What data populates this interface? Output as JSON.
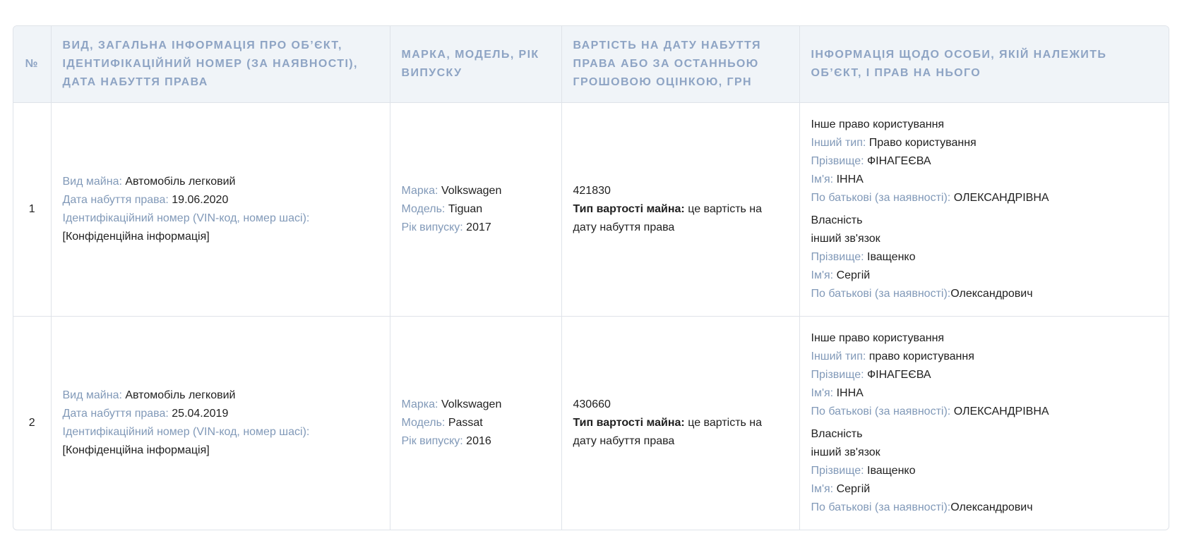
{
  "table": {
    "headers": {
      "num": "№",
      "general": "ВИД, ЗАГАЛЬНА ІНФОРМАЦІЯ ПРО ОБ’ЄКТ, ІДЕНТИФІКАЦІЙНИЙ НОМЕР (ЗА НАЯВНОСТІ), ДАТА НАБУТТЯ ПРАВА",
      "brand": "МАРКА, МОДЕЛЬ, РІК ВИПУСКУ",
      "value": "ВАРТІСТЬ НА ДАТУ НАБУТТЯ ПРАВА АБО ЗА ОСТАННЬОЮ ГРОШОВОЮ ОЦІНКОЮ, ГРН",
      "owner": "ІНФОРМАЦІЯ ЩОДО ОСОБИ, ЯКІЙ НАЛЕЖИТЬ ОБ’ЄКТ, І ПРАВ НА НЬОГО"
    },
    "rows": [
      {
        "num": "1",
        "general": {
          "type_label": "Вид майна:",
          "type_value": "Автомобіль легковий",
          "date_label": "Дата набуття права:",
          "date_value": "19.06.2020",
          "id_label": "Ідентифікаційний номер (VIN-код, номер шасі):",
          "id_value": "[Конфіденційна інформація]"
        },
        "brand": {
          "brand_label": "Марка:",
          "brand_value": "Volkswagen",
          "model_label": "Модель:",
          "model_value": "Tiguan",
          "year_label": "Рік випуску:",
          "year_value": "2017"
        },
        "value": {
          "amount": "421830",
          "cost_type_label": "Тип вартості майна:",
          "cost_type_value": "це вартість на дату набуття права"
        },
        "owner": {
          "right1": "Інше право користування",
          "other_type_label": "Інший тип:",
          "other_type_value": "Право користування",
          "surname_label": "Прізвище:",
          "surname_value": "ФІНАГЕЄВА",
          "name_label": "Ім'я:",
          "name_value": "ІННА",
          "patronymic_label": "По батькові (за наявності):",
          "patronymic_value": "ОЛЕКСАНДРІВНА",
          "right2": "Власність",
          "relation": "інший зв'язок",
          "surname2_label": "Прізвище:",
          "surname2_value": "Іващенко",
          "name2_label": "Ім'я:",
          "name2_value": "Сергій",
          "patronymic2_label": "По батькові (за наявності):",
          "patronymic2_value": "Олександрович"
        }
      },
      {
        "num": "2",
        "general": {
          "type_label": "Вид майна:",
          "type_value": "Автомобіль легковий",
          "date_label": "Дата набуття права:",
          "date_value": "25.04.2019",
          "id_label": "Ідентифікаційний номер (VIN-код, номер шасі):",
          "id_value": "[Конфіденційна інформація]"
        },
        "brand": {
          "brand_label": "Марка:",
          "brand_value": "Volkswagen",
          "model_label": "Модель:",
          "model_value": "Passat",
          "year_label": "Рік випуску:",
          "year_value": "2016"
        },
        "value": {
          "amount": "430660",
          "cost_type_label": "Тип вартості майна:",
          "cost_type_value": "це вартість на дату набуття права"
        },
        "owner": {
          "right1": "Інше право користування",
          "other_type_label": "Інший тип:",
          "other_type_value": "право користування",
          "surname_label": "Прізвище:",
          "surname_value": "ФІНАГЕЄВА",
          "name_label": "Ім'я:",
          "name_value": "ІННА",
          "patronymic_label": "По батькові (за наявності):",
          "patronymic_value": "ОЛЕКСАНДРІВНА",
          "right2": "Власність",
          "relation": "інший зв'язок",
          "surname2_label": "Прізвище:",
          "surname2_value": "Іващенко",
          "name2_label": "Ім'я:",
          "name2_value": "Сергій",
          "patronymic2_label": "По батькові (за наявності):",
          "patronymic2_value": "Олександрович"
        }
      }
    ]
  }
}
